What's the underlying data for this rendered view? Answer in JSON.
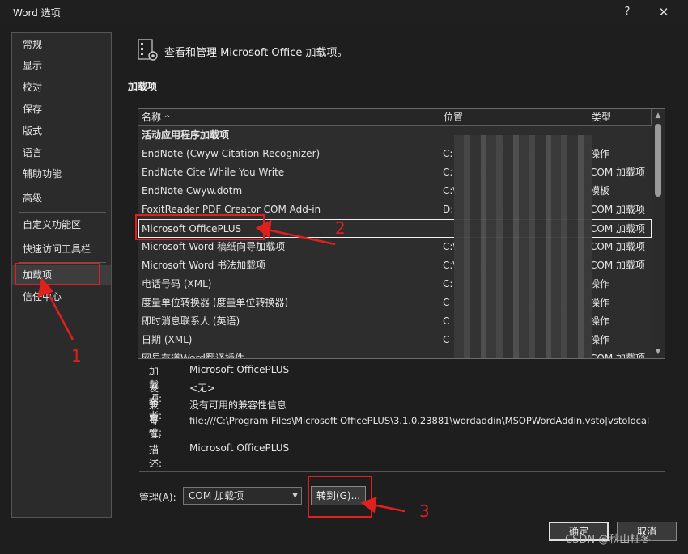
{
  "window": {
    "title": "Word 选项",
    "help": "?",
    "close": "✕"
  },
  "sidebar": {
    "items": [
      {
        "label": "常规"
      },
      {
        "label": "显示"
      },
      {
        "label": "校对"
      },
      {
        "label": "保存"
      },
      {
        "label": "版式"
      },
      {
        "label": "语言"
      },
      {
        "label": "辅助功能"
      },
      {
        "label": "高级"
      },
      {
        "label": "自定义功能区"
      },
      {
        "label": "快速访问工具栏"
      },
      {
        "label": "加载项"
      },
      {
        "label": "信任中心"
      }
    ]
  },
  "header": {
    "text": "查看和管理 Microsoft Office 加载项。"
  },
  "section": {
    "title": "加载项"
  },
  "table": {
    "columns": {
      "name": "名称",
      "location": "位置",
      "type": "类型"
    },
    "sort_indicator": "^",
    "group": "活动应用程序加载项",
    "rows": [
      {
        "name": "EndNote (Cwyw Citation Recognizer)",
        "location": "C:",
        "type": "操作"
      },
      {
        "name": "EndNote Cite While You Write",
        "location": "C:",
        "type": "COM 加载项"
      },
      {
        "name": "EndNote Cwyw.dotm",
        "location": "C:\\",
        "type": "模板"
      },
      {
        "name": "FoxitReader PDF Creator COM Add-in",
        "location": "D:",
        "type": "COM 加载项"
      },
      {
        "name": "Microsoft OfficePLUS",
        "location": "",
        "type": "COM 加载项"
      },
      {
        "name": "Microsoft Word 稿纸向导加载项",
        "location": "C:\\",
        "type": "COM 加载项"
      },
      {
        "name": "Microsoft Word 书法加载项",
        "location": "C:\\",
        "type": "COM 加载项"
      },
      {
        "name": "电话号码 (XML)",
        "location": "C:",
        "type": "操作"
      },
      {
        "name": "度量单位转换器 (度量单位转换器)",
        "location": "C",
        "type": "操作"
      },
      {
        "name": "即时消息联系人 (英语)",
        "location": "C",
        "type": "操作"
      },
      {
        "name": "日期 (XML)",
        "location": "C",
        "type": "操作"
      },
      {
        "name": "网易有道Word翻译插件",
        "location": "",
        "type": "COM 加载项"
      }
    ]
  },
  "details": {
    "addin_label": "加载项:",
    "addin_value": "Microsoft OfficePLUS",
    "publisher_label": "发布者:",
    "publisher_value": "<无>",
    "compat_label": "兼容性:",
    "compat_value": "没有可用的兼容性信息",
    "location_label": "位置:",
    "location_value": "file:///C:\\Program Files\\Microsoft OfficePLUS\\3.1.0.23881\\wordaddin\\MSOPWordAddin.vsto|vstolocal",
    "desc_label": "描述:",
    "desc_value": "Microsoft OfficePLUS"
  },
  "manage": {
    "label": "管理(A):",
    "selected": "COM 加载项",
    "goto": "转到(G)..."
  },
  "footer": {
    "ok": "确定",
    "cancel": "取消"
  },
  "watermark": "CSDN @秋山枉冬",
  "annotations": {
    "n1": "1",
    "n2": "2",
    "n3": "3"
  }
}
